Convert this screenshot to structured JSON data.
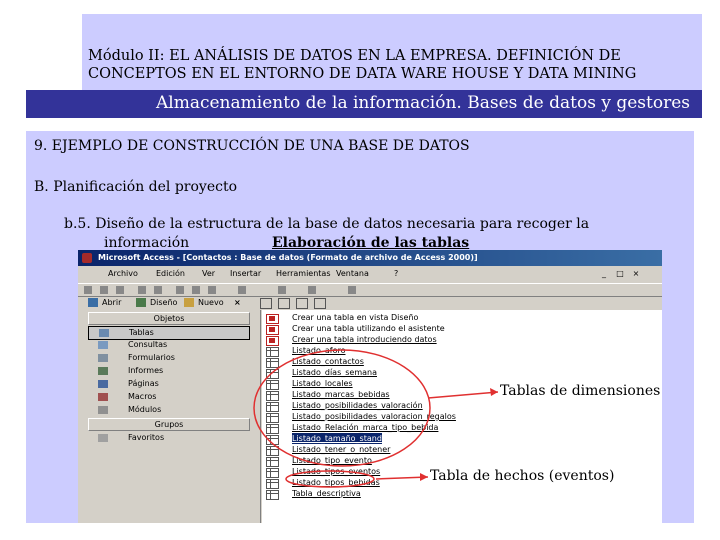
{
  "header": {
    "module_line1": "Módulo II: EL ANÁLISIS DE DATOS EN LA EMPRESA. DEFINICIÓN DE",
    "module_line2": "CONCEPTOS EN EL ENTORNO DE DATA WARE HOUSE Y DATA MINING",
    "band_title": "Almacenamiento de la información. Bases de datos y gestores"
  },
  "content": {
    "section": "9. EJEMPLO DE CONSTRUCCIÓN DE UNA BASE DE DATOS",
    "subsection": "B. Planificación del proyecto",
    "item_line1": "b.5. Diseño de la estructura de la base de datos necesaria para recoger la",
    "item_line2": "información",
    "item_emphasis": "Elaboración de las tablas"
  },
  "access_window": {
    "title": "Microsoft Access - [Contactos : Base de datos (Formato de archivo de Access 2000)]",
    "menu": [
      "Archivo",
      "Edición",
      "Ver",
      "Insertar",
      "Herramientas",
      "Ventana",
      "?"
    ],
    "window_buttons": [
      "_",
      "□",
      "×"
    ],
    "toolbar": {
      "open": "Abrir",
      "design": "Diseño",
      "new": "Nuevo",
      "delete": "×"
    },
    "sidebar": {
      "objects_header": "Objetos",
      "objects": [
        "Tablas",
        "Consultas",
        "Formularios",
        "Informes",
        "Páginas",
        "Macros",
        "Módulos"
      ],
      "groups_header": "Grupos",
      "groups": [
        "Favoritos"
      ]
    },
    "list": [
      {
        "label": "Crear una tabla en vista Diseño",
        "kind": "wizard"
      },
      {
        "label": "Crear una tabla utilizando el asistente",
        "kind": "wizard"
      },
      {
        "label": "Crear una tabla introduciendo datos",
        "kind": "wizard"
      },
      {
        "label": "Listado_aforo",
        "kind": "table"
      },
      {
        "label": "Listado_contactos",
        "kind": "table"
      },
      {
        "label": "Listado_días_semana",
        "kind": "table"
      },
      {
        "label": "Listado_locales",
        "kind": "table"
      },
      {
        "label": "Listado_marcas_bebidas",
        "kind": "table"
      },
      {
        "label": "Listado_posibilidades_valoración",
        "kind": "table"
      },
      {
        "label": "Listado_posibilidades_valoracion_regalos",
        "kind": "table"
      },
      {
        "label": "Listado_Relación_marca_tipo_bebida",
        "kind": "table"
      },
      {
        "label": "Listado_tamaño_stand",
        "kind": "table",
        "selected": true
      },
      {
        "label": "Listado_tener_o_notener",
        "kind": "table"
      },
      {
        "label": "Listado_tipo_evento",
        "kind": "table"
      },
      {
        "label": "Listado_tipos_eventos",
        "kind": "table"
      },
      {
        "label": "Listado_tipos_bebidas",
        "kind": "table"
      },
      {
        "label": "Tabla_descriptiva",
        "kind": "table"
      }
    ]
  },
  "annotations": {
    "dimensions": "Tablas de dimensiones",
    "facts": "Tabla de hechos (eventos)",
    "color": "#e03030"
  }
}
